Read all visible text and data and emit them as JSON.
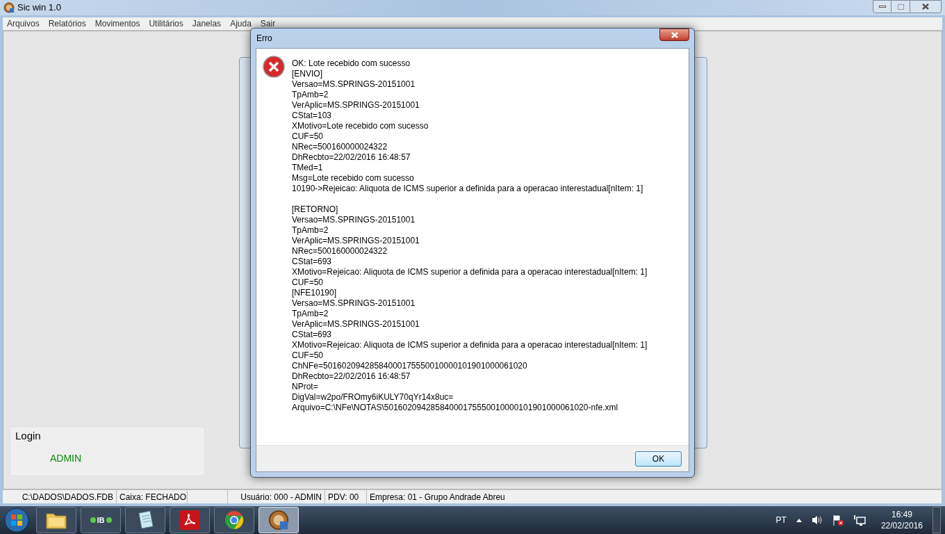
{
  "window": {
    "title": "Sic win 1.0"
  },
  "menu": [
    "Arquivos",
    "Relatórios",
    "Movimentos",
    "Utilitários",
    "Janelas",
    "Ajuda",
    "Sair"
  ],
  "login": {
    "title": "Login",
    "user": "ADMIN"
  },
  "dialog": {
    "title": "Erro",
    "paragraphs": [
      [
        "OK: Lote recebido com sucesso",
        "[ENVIO]",
        "Versao=MS.SPRINGS-20151001",
        "TpAmb=2",
        "VerAplic=MS.SPRINGS-20151001",
        "CStat=103",
        "XMotivo=Lote recebido com sucesso",
        "CUF=50",
        "NRec=500160000024322",
        "DhRecbto=22/02/2016 16:48:57",
        "TMed=1",
        "Msg=Lote recebido com sucesso",
        "10190->Rejeicao: Aliquota de ICMS superior a definida para a operacao interestadual[nItem: 1]"
      ],
      [
        "[RETORNO]",
        "Versao=MS.SPRINGS-20151001",
        "TpAmb=2",
        "VerAplic=MS.SPRINGS-20151001",
        "NRec=500160000024322",
        "CStat=693",
        "XMotivo=Rejeicao: Aliquota de ICMS superior a definida para a operacao interestadual[nItem: 1]",
        "CUF=50",
        "[NFE10190]",
        "Versao=MS.SPRINGS-20151001",
        "TpAmb=2",
        "VerAplic=MS.SPRINGS-20151001",
        "CStat=693",
        "XMotivo=Rejeicao: Aliquota de ICMS superior a definida para a operacao interestadual[nItem: 1]",
        "CUF=50",
        "ChNFe=50160209428584000175550010000101901000061020",
        "DhRecbto=22/02/2016 16:48:57",
        "NProt=",
        "DigVal=w2po/FROmy6iKULY70qYr14x8uc=",
        "Arquivo=C:\\NFe\\NOTAS\\50160209428584000175550010000101901000061020-nfe.xml"
      ]
    ],
    "button": "OK"
  },
  "status_bar": [
    "C:\\DADOS\\DADOS.FDB",
    "Caixa: FECHADO",
    "Usuário: 000 - ADMIN",
    "PDV: 00",
    "Empresa: 01 - Grupo Andrade Abreu"
  ],
  "taskbar": {
    "apps": [
      {
        "kind": "folder",
        "selected": false
      },
      {
        "kind": "ib",
        "label": "IB",
        "selected": false
      },
      {
        "kind": "notepad",
        "selected": false
      },
      {
        "kind": "pdf",
        "selected": false
      },
      {
        "kind": "chrome",
        "selected": false
      },
      {
        "kind": "app",
        "selected": true
      }
    ],
    "language": "PT",
    "time": "16:49",
    "date": "22/02/2016"
  }
}
